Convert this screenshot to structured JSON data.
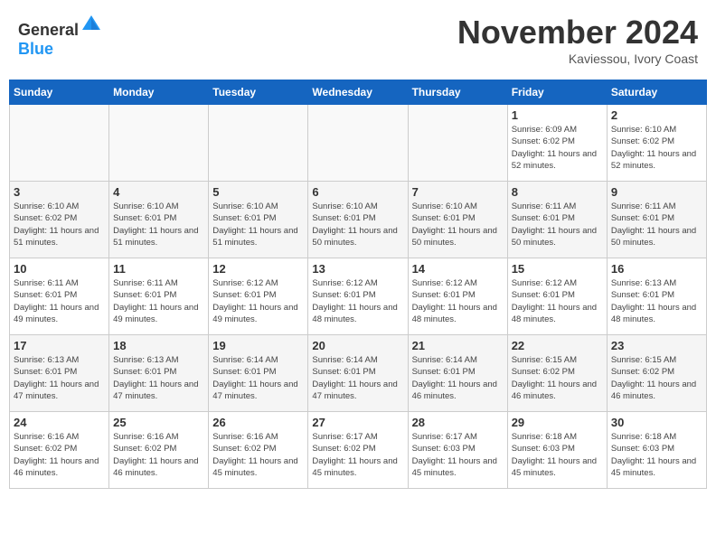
{
  "header": {
    "logo_general": "General",
    "logo_blue": "Blue",
    "month": "November 2024",
    "location": "Kaviessou, Ivory Coast"
  },
  "weekdays": [
    "Sunday",
    "Monday",
    "Tuesday",
    "Wednesday",
    "Thursday",
    "Friday",
    "Saturday"
  ],
  "weeks": [
    [
      {
        "day": "",
        "info": ""
      },
      {
        "day": "",
        "info": ""
      },
      {
        "day": "",
        "info": ""
      },
      {
        "day": "",
        "info": ""
      },
      {
        "day": "",
        "info": ""
      },
      {
        "day": "1",
        "info": "Sunrise: 6:09 AM\nSunset: 6:02 PM\nDaylight: 11 hours and 52 minutes."
      },
      {
        "day": "2",
        "info": "Sunrise: 6:10 AM\nSunset: 6:02 PM\nDaylight: 11 hours and 52 minutes."
      }
    ],
    [
      {
        "day": "3",
        "info": "Sunrise: 6:10 AM\nSunset: 6:02 PM\nDaylight: 11 hours and 51 minutes."
      },
      {
        "day": "4",
        "info": "Sunrise: 6:10 AM\nSunset: 6:01 PM\nDaylight: 11 hours and 51 minutes."
      },
      {
        "day": "5",
        "info": "Sunrise: 6:10 AM\nSunset: 6:01 PM\nDaylight: 11 hours and 51 minutes."
      },
      {
        "day": "6",
        "info": "Sunrise: 6:10 AM\nSunset: 6:01 PM\nDaylight: 11 hours and 50 minutes."
      },
      {
        "day": "7",
        "info": "Sunrise: 6:10 AM\nSunset: 6:01 PM\nDaylight: 11 hours and 50 minutes."
      },
      {
        "day": "8",
        "info": "Sunrise: 6:11 AM\nSunset: 6:01 PM\nDaylight: 11 hours and 50 minutes."
      },
      {
        "day": "9",
        "info": "Sunrise: 6:11 AM\nSunset: 6:01 PM\nDaylight: 11 hours and 50 minutes."
      }
    ],
    [
      {
        "day": "10",
        "info": "Sunrise: 6:11 AM\nSunset: 6:01 PM\nDaylight: 11 hours and 49 minutes."
      },
      {
        "day": "11",
        "info": "Sunrise: 6:11 AM\nSunset: 6:01 PM\nDaylight: 11 hours and 49 minutes."
      },
      {
        "day": "12",
        "info": "Sunrise: 6:12 AM\nSunset: 6:01 PM\nDaylight: 11 hours and 49 minutes."
      },
      {
        "day": "13",
        "info": "Sunrise: 6:12 AM\nSunset: 6:01 PM\nDaylight: 11 hours and 48 minutes."
      },
      {
        "day": "14",
        "info": "Sunrise: 6:12 AM\nSunset: 6:01 PM\nDaylight: 11 hours and 48 minutes."
      },
      {
        "day": "15",
        "info": "Sunrise: 6:12 AM\nSunset: 6:01 PM\nDaylight: 11 hours and 48 minutes."
      },
      {
        "day": "16",
        "info": "Sunrise: 6:13 AM\nSunset: 6:01 PM\nDaylight: 11 hours and 48 minutes."
      }
    ],
    [
      {
        "day": "17",
        "info": "Sunrise: 6:13 AM\nSunset: 6:01 PM\nDaylight: 11 hours and 47 minutes."
      },
      {
        "day": "18",
        "info": "Sunrise: 6:13 AM\nSunset: 6:01 PM\nDaylight: 11 hours and 47 minutes."
      },
      {
        "day": "19",
        "info": "Sunrise: 6:14 AM\nSunset: 6:01 PM\nDaylight: 11 hours and 47 minutes."
      },
      {
        "day": "20",
        "info": "Sunrise: 6:14 AM\nSunset: 6:01 PM\nDaylight: 11 hours and 47 minutes."
      },
      {
        "day": "21",
        "info": "Sunrise: 6:14 AM\nSunset: 6:01 PM\nDaylight: 11 hours and 46 minutes."
      },
      {
        "day": "22",
        "info": "Sunrise: 6:15 AM\nSunset: 6:02 PM\nDaylight: 11 hours and 46 minutes."
      },
      {
        "day": "23",
        "info": "Sunrise: 6:15 AM\nSunset: 6:02 PM\nDaylight: 11 hours and 46 minutes."
      }
    ],
    [
      {
        "day": "24",
        "info": "Sunrise: 6:16 AM\nSunset: 6:02 PM\nDaylight: 11 hours and 46 minutes."
      },
      {
        "day": "25",
        "info": "Sunrise: 6:16 AM\nSunset: 6:02 PM\nDaylight: 11 hours and 46 minutes."
      },
      {
        "day": "26",
        "info": "Sunrise: 6:16 AM\nSunset: 6:02 PM\nDaylight: 11 hours and 45 minutes."
      },
      {
        "day": "27",
        "info": "Sunrise: 6:17 AM\nSunset: 6:02 PM\nDaylight: 11 hours and 45 minutes."
      },
      {
        "day": "28",
        "info": "Sunrise: 6:17 AM\nSunset: 6:03 PM\nDaylight: 11 hours and 45 minutes."
      },
      {
        "day": "29",
        "info": "Sunrise: 6:18 AM\nSunset: 6:03 PM\nDaylight: 11 hours and 45 minutes."
      },
      {
        "day": "30",
        "info": "Sunrise: 6:18 AM\nSunset: 6:03 PM\nDaylight: 11 hours and 45 minutes."
      }
    ]
  ]
}
